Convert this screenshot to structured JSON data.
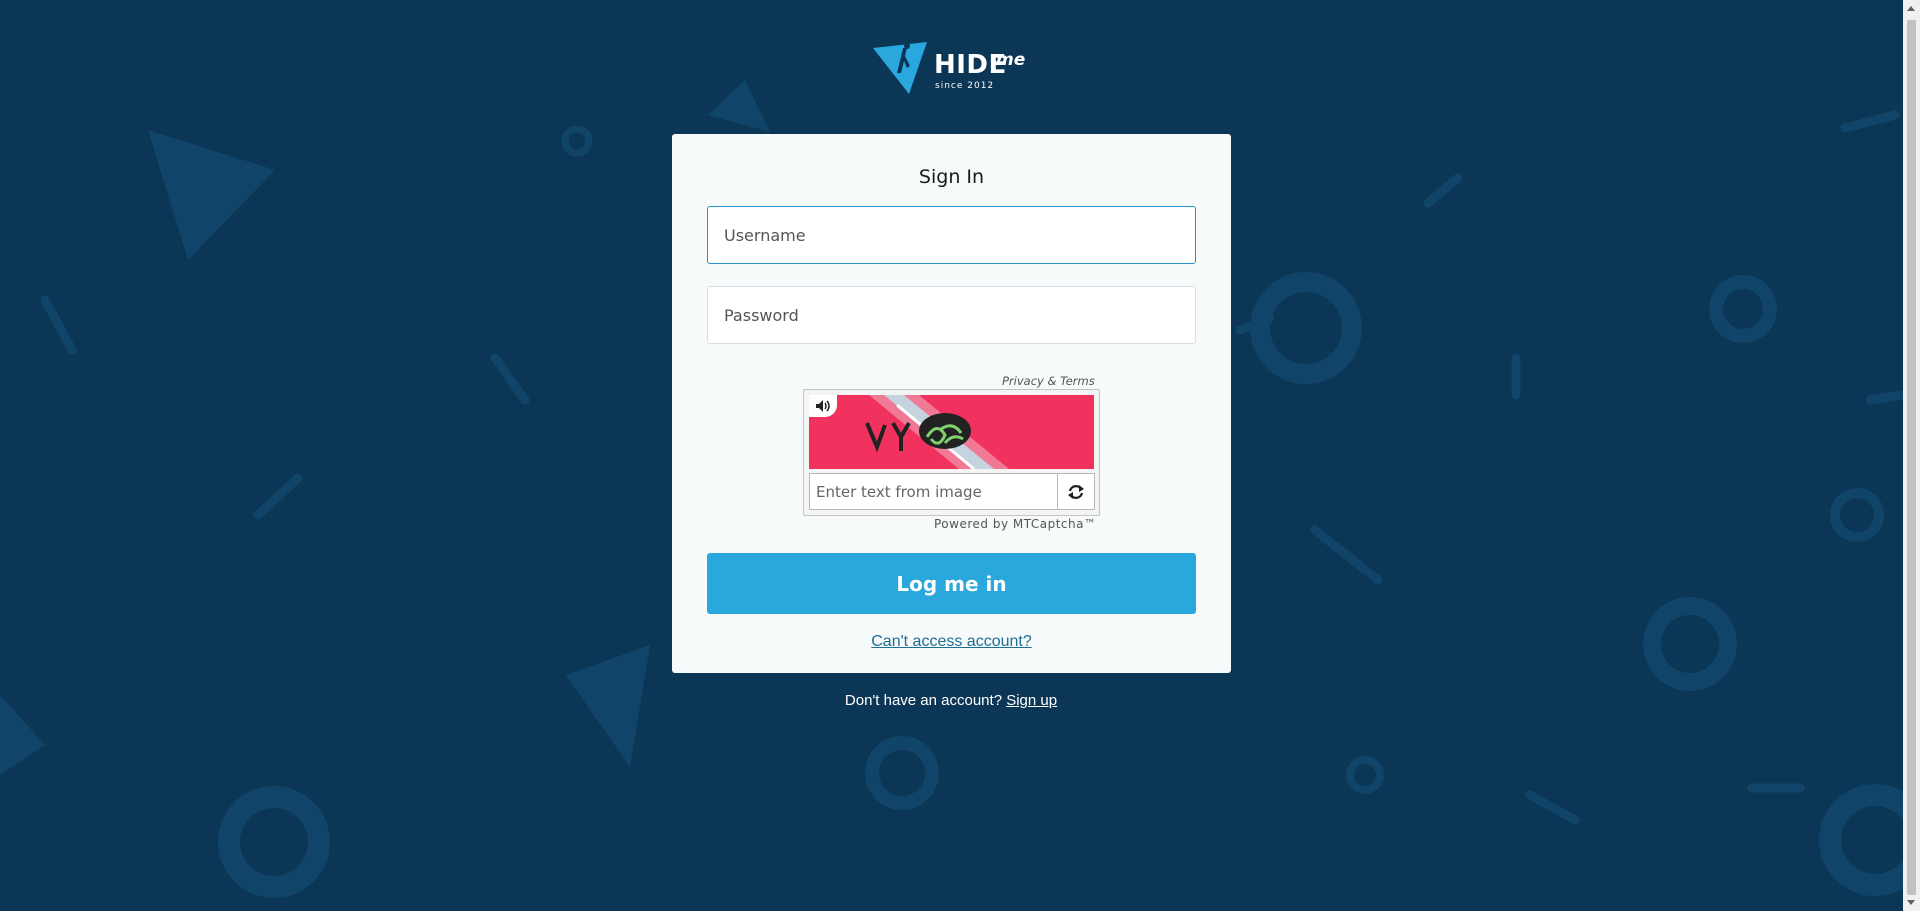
{
  "brand": {
    "name": "HIDE",
    "suffix": "me",
    "tagline": "since 2012",
    "accent_color": "#2aa8de",
    "background_color": "#0c3655"
  },
  "login_form": {
    "title": "Sign In",
    "username_placeholder": "Username",
    "password_placeholder": "Password",
    "submit_label": "Log me in",
    "recovery_link": "Can't access account?"
  },
  "captcha": {
    "privacy_link": "Privacy & Terms",
    "input_placeholder": "Enter text from image",
    "powered_by": "Powered by MTCaptcha™",
    "audio_icon": "speaker-icon",
    "refresh_icon": "refresh-icon"
  },
  "signup": {
    "prompt": "Don't have an account?",
    "link": "Sign up"
  }
}
